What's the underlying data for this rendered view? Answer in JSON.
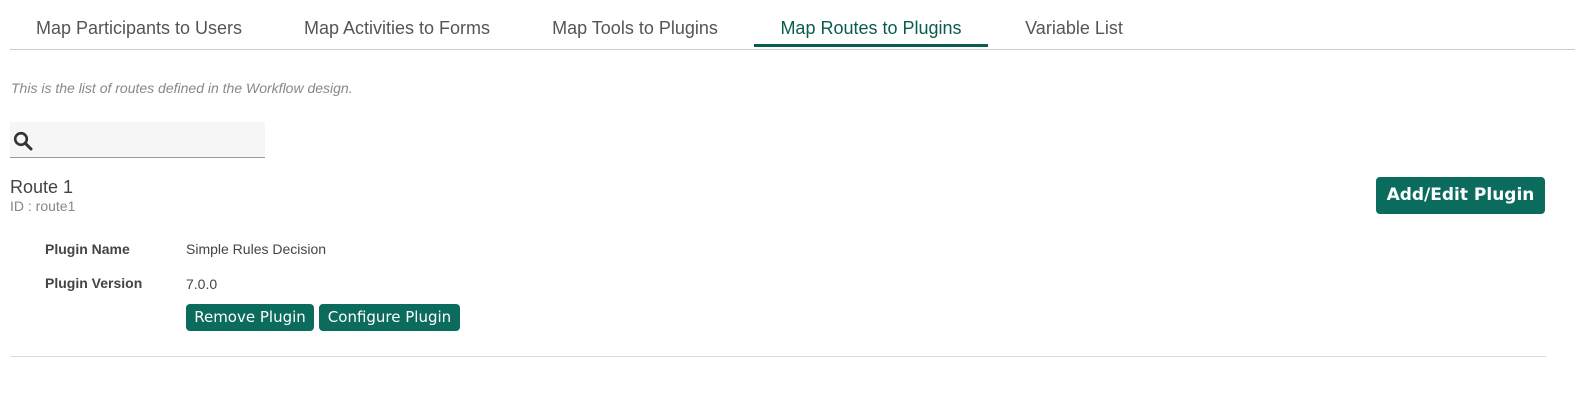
{
  "tabs": [
    {
      "label": "Map Participants to Users",
      "active": false
    },
    {
      "label": "Map Activities to Forms",
      "active": false
    },
    {
      "label": "Map Tools to Plugins",
      "active": false
    },
    {
      "label": "Map Routes to Plugins",
      "active": true
    },
    {
      "label": "Variable List",
      "active": false
    }
  ],
  "description": "This is the list of routes defined in the Workflow design.",
  "search": {
    "icon": "search-icon",
    "placeholder": "",
    "value": ""
  },
  "route": {
    "title": "Route 1",
    "id_text": "ID : route1",
    "add_edit_label": "Add/Edit Plugin",
    "plugin_name_label": "Plugin Name",
    "plugin_name_value": "Simple Rules Decision",
    "plugin_version_label": "Plugin Version",
    "plugin_version_value": "7.0.0",
    "remove_label": "Remove Plugin",
    "configure_label": "Configure Plugin"
  },
  "colors": {
    "accent": "#0b5c4f",
    "button": "#0b6b5c"
  }
}
